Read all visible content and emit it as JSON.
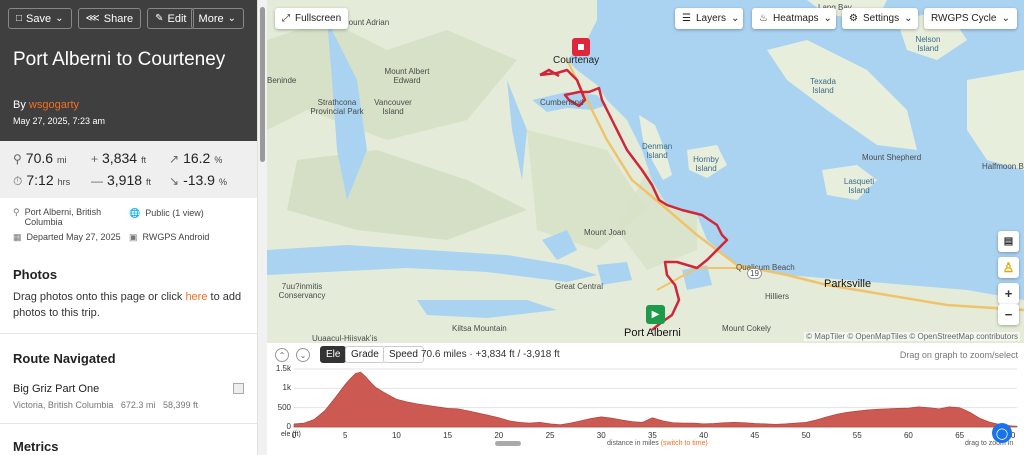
{
  "toolbar": {
    "save": "Save",
    "share": "Share",
    "edit": "Edit",
    "more": "More"
  },
  "trip": {
    "title": "Port Alberni to Courteney",
    "by_prefix": "By",
    "author": "wsgogarty",
    "date": "May 27, 2025, 7:23 am"
  },
  "stats": {
    "distance": "70.6",
    "distance_unit": "mi",
    "elev_gain": "3,834",
    "elev_gain_unit": "ft",
    "max_grade": "16.2",
    "max_grade_unit": "%",
    "moving_time": "7:12",
    "moving_time_unit": "hrs",
    "elev_loss": "3,918",
    "elev_loss_unit": "ft",
    "min_grade": "-13.9",
    "min_grade_unit": "%"
  },
  "meta": {
    "location": "Port Alberni, British Columbia",
    "visibility": "Public (1 view)",
    "departed": "Departed May 27, 2025",
    "device": "RWGPS Android"
  },
  "photos": {
    "title": "Photos",
    "text_before": "Drag photos onto this page or click ",
    "link": "here",
    "text_after": " to add photos to this trip."
  },
  "route_navigated": {
    "title": "Route Navigated",
    "name": "Big Griz Part One",
    "location": "Victoria, British Columbia",
    "distance": "672.3 mi",
    "elevation": "58,399 ft"
  },
  "metrics": {
    "title": "Metrics"
  },
  "map": {
    "fullscreen": "Fullscreen",
    "layers": "Layers",
    "heatmaps": "Heatmaps",
    "settings": "Settings",
    "basemap": "RWGPS Cycle",
    "attribution": "© MapTiler © OpenMapTiles © OpenStreetMap contributors",
    "labels": {
      "courtenay": "Courtenay",
      "cumberland": "Cumberland",
      "port_alberni": "Port Alberni",
      "parksville": "Parksville",
      "qualicum": "Qualicum Beach",
      "hilliers": "Hilliers",
      "great_central": "Great Central",
      "strathcona": "Strathcona Provincial Park",
      "mount_albert_edward": "Mount Albert Edward",
      "vancouver_island": "Vancouver Island",
      "mount_adrian": "Mount Adrian",
      "mount_joan": "Mount Joan",
      "kiltsa": "Kiltsa Mountain",
      "mount_cokely": "Mount Cokely",
      "denman": "Denman Island",
      "hornby": "Hornby Island",
      "texada": "Texada Island",
      "lasqueti": "Lasqueti Island",
      "mount_shepherd": "Mount Shepherd",
      "nelson": "Nelson Island",
      "halfmoon": "Halfmoon B",
      "lang_bay": "Lang Bay",
      "beninde": "Beninde",
      "conservancy": "7uu?inmitis Conservancy",
      "uukwatis": "Uuaacul-Hiisvakʼis",
      "hwy19": "19"
    }
  },
  "elevation": {
    "tabs": [
      "Ele",
      "Grade",
      "Speed"
    ],
    "active_tab": "Ele",
    "summary": "70.6 miles · +3,834 ft / -3,918 ft",
    "hint": "Drag on graph to zoom/select",
    "unit_label": "ele (ft)",
    "x_axis_label": "distance in miles",
    "switch_link": "(switch to time)",
    "drag_hint": "drag to zoom in",
    "y_ticks": [
      "1.5k",
      "1k",
      "500",
      "0"
    ],
    "x_ticks": [
      "0",
      "5",
      "10",
      "15",
      "20",
      "25",
      "30",
      "35",
      "40",
      "45",
      "50",
      "55",
      "60",
      "65",
      "70"
    ]
  },
  "chart_data": {
    "type": "area",
    "xlabel": "distance in miles",
    "ylabel": "ele (ft)",
    "xlim": [
      0,
      70.6
    ],
    "ylim": [
      0,
      1500
    ],
    "color": "#cc5a52",
    "x": [
      0,
      1,
      2,
      3,
      4,
      5,
      5.5,
      6,
      6.5,
      7,
      7.5,
      8,
      9,
      10,
      11,
      12,
      13,
      14,
      15,
      16,
      17,
      18,
      19,
      20,
      21,
      22,
      23,
      24,
      25,
      26,
      27,
      28,
      29,
      30,
      31,
      32,
      33,
      34,
      35,
      36,
      37,
      38,
      39,
      40,
      41,
      42,
      43,
      44,
      45,
      46,
      47,
      48,
      49,
      50,
      51,
      52,
      53,
      54,
      55,
      56,
      57,
      58,
      59,
      60,
      61,
      62,
      63,
      64,
      65,
      66,
      67,
      68,
      69,
      70,
      70.6
    ],
    "y": [
      80,
      100,
      200,
      420,
      750,
      1100,
      1250,
      1380,
      1420,
      1300,
      1150,
      1020,
      860,
      720,
      650,
      600,
      560,
      520,
      480,
      470,
      420,
      360,
      300,
      240,
      160,
      120,
      100,
      120,
      80,
      60,
      100,
      160,
      220,
      260,
      230,
      180,
      140,
      120,
      240,
      160,
      110,
      100,
      100,
      80,
      90,
      110,
      120,
      110,
      90,
      80,
      70,
      80,
      100,
      120,
      180,
      260,
      330,
      380,
      410,
      440,
      460,
      470,
      480,
      490,
      520,
      500,
      470,
      520,
      500,
      380,
      220,
      120,
      60,
      30,
      20
    ]
  }
}
